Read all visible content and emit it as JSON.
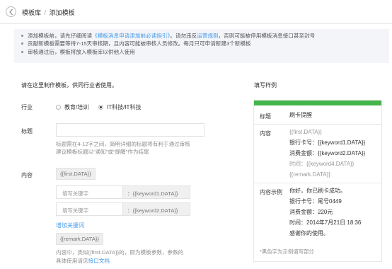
{
  "header": {
    "breadcrumb_root": "模板库",
    "breadcrumb_sep": "/",
    "breadcrumb_current": "添加模板"
  },
  "notice": {
    "line1_prefix": "添加模板前，请先仔细阅读",
    "line1_link": "《模板消息申请添加前必读指引》",
    "line1_mid": "。请勿违反",
    "line1_link2": "运营规则",
    "line1_suffix": "，否则可能被停用模板消息接口甚至封号",
    "line2": "贡献新模板需要等待7-15天审核期，且内容可能被审核人员修改。每月只可申请新建3个新模板",
    "line3": "审核通过后，模板将放入模板库以供他人使用"
  },
  "form": {
    "intro": "请在这里制作模板，供同行业者使用。",
    "industry_label": "行业",
    "industry_options": [
      {
        "label": "教育/培训",
        "selected": false
      },
      {
        "label": "IT科技/IT科技",
        "selected": true
      }
    ],
    "title_label": "标题",
    "title_value": "",
    "title_hint_1": "标题需在4-12字之间，简明详细的标题将有利于通过审核",
    "title_hint_2": "建议模板标题以“通知”或“提醒”作为结尾",
    "content_label": "内容",
    "first_tag": "{{first.DATA}}",
    "keywords": [
      {
        "placeholder": "填写关键字",
        "addon": "：{{keyword1.DATA}}"
      },
      {
        "placeholder": "填写关键字",
        "addon": "：{{keyword2.DATA}}"
      }
    ],
    "add_keyword": "增加关键词",
    "remark_tag": "{{remark.DATA}}",
    "content_hint_1": "内容中，类似{{first.DATA}}的，即为模板参数，参数的",
    "content_hint_2_prefix": "具体使用请见",
    "content_hint_2_link": "接口文档"
  },
  "sample": {
    "heading": "填写样例",
    "accent_color": "#44b549",
    "title_key": "标题",
    "title_value": "刷卡提醒",
    "content_key": "内容",
    "content_lines": [
      "{{first.DATA}}",
      "银行卡号：{{keyword1.DATA}}",
      "消费金额：{{keyword2.DATA}}",
      "时间：{{keyword4.DATA}}",
      "{{remark.DATA}}"
    ],
    "example_key": "内容示例",
    "example_lines": [
      "你好，你已刷卡成功。",
      "银行卡号：尾号0449",
      "消费金额：220元",
      "时间：2014年7月21日 18:36",
      "感谢你的使用。"
    ],
    "footnote": "*黑色字为示例填写部分"
  }
}
